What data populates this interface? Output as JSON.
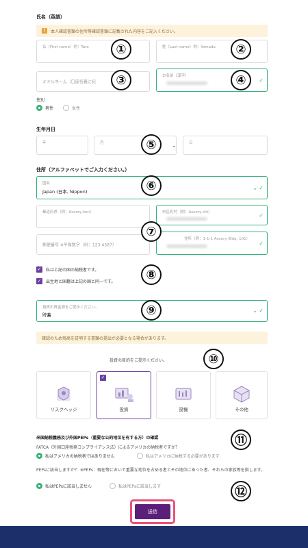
{
  "name_section": {
    "title": "氏名（英語）",
    "notice": "本人確認書類の住所等確認書類に記載された内容をご記入ください。",
    "first_name_placeholder": "名（First name）例：Taro",
    "last_name_placeholder": "姓（Last name）例：Yamada",
    "middle_name_placeholder": "ミドルネーム（口座名義に記",
    "kanji_name_label": "お名前（漢字）"
  },
  "gender": {
    "label": "性別",
    "options": [
      "男性",
      "女性"
    ],
    "selected": "男性"
  },
  "birthdate": {
    "title": "生年月日",
    "year_label": "年",
    "month_label": "月",
    "day_label": "日"
  },
  "address": {
    "title": "住所（アルファベットでご入力ください。）",
    "country_label": "国名",
    "country_value": "Japan (日本, Nippon)",
    "prefecture_placeholder": "都道府県（例：Asoory-ken）",
    "city_placeholder": "市区町村（例：Asoory-shi）",
    "postal_placeholder": "郵便番号 ※半角数字（例：123-4567）",
    "street_placeholder": "住所（例：1-1-1 Asoory Bldg. 101）"
  },
  "tax_checks": [
    "私は上記の国の納税者です。",
    "出生地と国籍は上記の国と同一です。"
  ],
  "funds": {
    "label": "投資の資金源をご提示ください。",
    "value": "貯蓄"
  },
  "funds_notice": "確認のため残高を証明する書類の提出が必要となる場合があります。",
  "purpose": {
    "label": "投資の目的をご提示ください。",
    "cards": [
      {
        "label": "リスクヘッジ",
        "icon": "risk-hedge-icon",
        "selected": false
      },
      {
        "label": "投資",
        "icon": "investment-icon",
        "selected": true
      },
      {
        "label": "投機",
        "icon": "speculation-icon",
        "selected": false
      },
      {
        "label": "その他",
        "icon": "other-icon",
        "selected": false
      }
    ]
  },
  "fatca": {
    "title": "米国納税義務及び外国PEPs（重要な公的地位を有する方）の確認",
    "question": "FATCA（外国口座税務コンプライアンス法）によるアメリカの納税者ですか？",
    "option_no": "私はアメリカの納税者ではありません",
    "option_yes": "私はアメリカに納税する必要があります"
  },
  "peps": {
    "question": "PEPsに該当しますか？ ※PEPs：現在等において重要な地位を占める者とその地位にあった者、それらの家族等を指します。",
    "option_no": "私はPEPsに該当しません",
    "option_yes": "私はPEPsに該当します"
  },
  "submit_label": "送信",
  "badges": [
    "①",
    "②",
    "③",
    "④",
    "⑤",
    "⑥",
    "⑦",
    "⑧",
    "⑨",
    "⑩",
    "⑪",
    "⑫"
  ],
  "colors": {
    "valid_green": "#36b07a",
    "purple": "#6b3fa0",
    "submit_bg": "#5b1f7a",
    "highlight_pink": "#e8527c",
    "notice_bg": "#fdf3dc",
    "footer": "#1c2f6b"
  }
}
